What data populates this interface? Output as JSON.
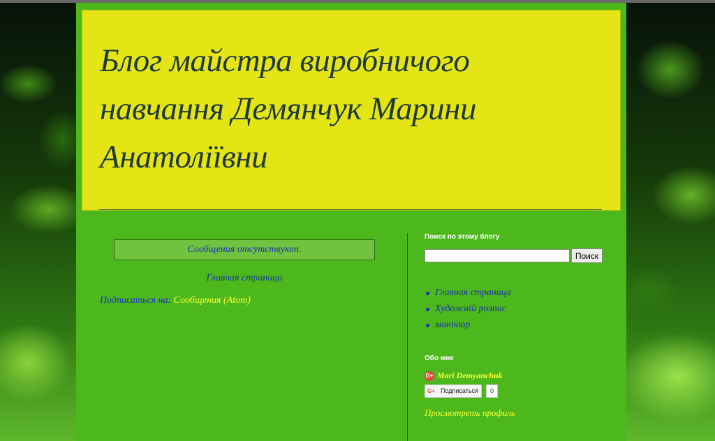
{
  "blog": {
    "title": "Блог майстра виробничого навчання Демянчук Марини Анатоліївни"
  },
  "main": {
    "no_posts": "Сообщения отсутствуют.",
    "home_link": "Главная страница",
    "subscribe_prefix": "Подписаться на:",
    "subscribe_link": "Сообщения",
    "feed_open": "(",
    "feed_type": "Atom",
    "feed_close": ")"
  },
  "sidebar": {
    "search": {
      "title": "Поиск по этому блогу",
      "input_value": "",
      "button_label": "Поиск"
    },
    "pages": [
      {
        "label": "Главная страница"
      },
      {
        "label": "Художній розпис"
      },
      {
        "label": "манікюр"
      }
    ],
    "about": {
      "title": "Обо мне",
      "author_name": "Mari Demyanchuk",
      "follow_label": "Подписаться",
      "follow_count": "0",
      "gplus_glyph": "G+",
      "view_profile": "Просмотреть профиль"
    }
  },
  "colors": {
    "page_bg": "#4cb81c",
    "header_bg": "#e5e516",
    "link_blue": "#1e2fb0",
    "link_yellow": "#ffff33"
  }
}
